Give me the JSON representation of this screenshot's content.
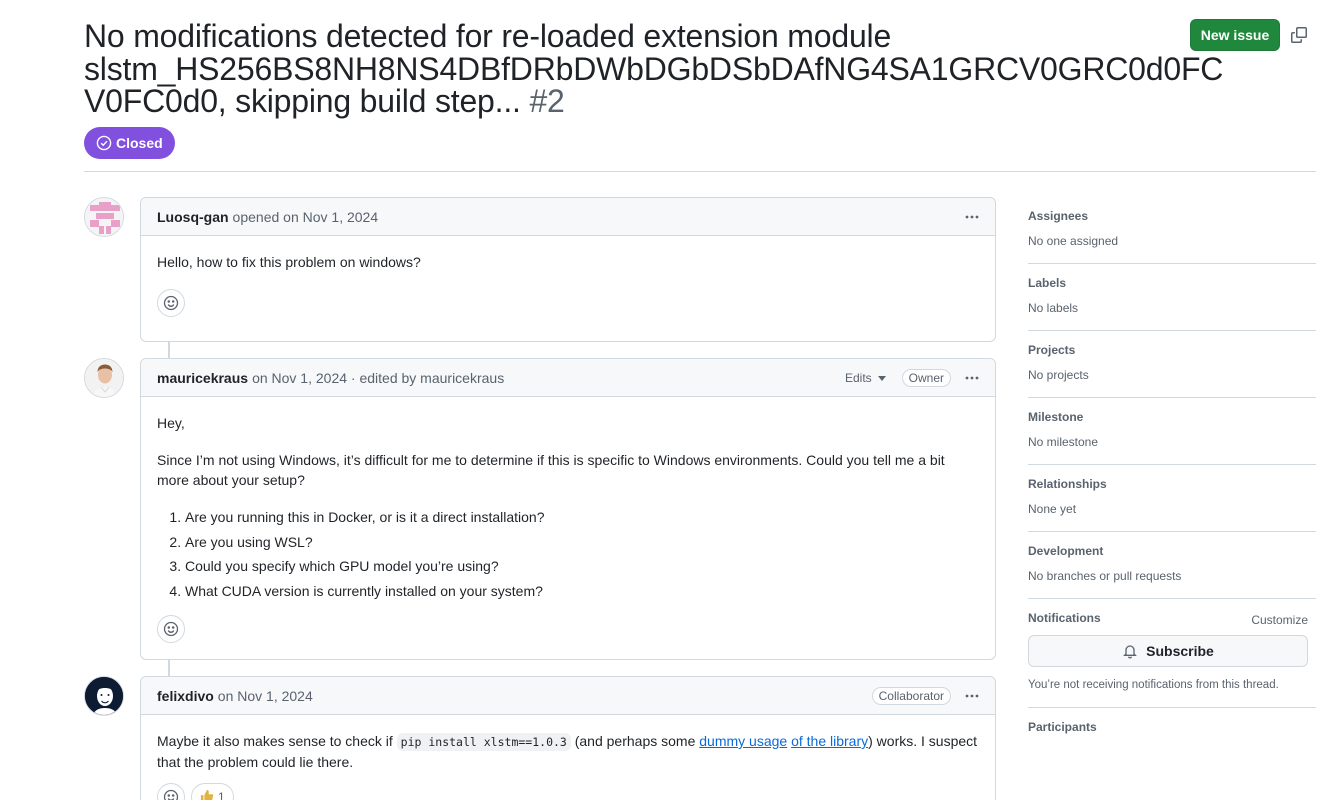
{
  "issue": {
    "title": "No modifications detected for re-loaded extension module slstm_HS256BS8NH8NS4DBfDRbDWbDGbDSbDAfNG4SA1GRCV0GRC0d0FC V0FC0d0, skipping build step...",
    "number": "#2",
    "state": "Closed"
  },
  "header": {
    "new_issue_label": "New issue"
  },
  "comments": [
    {
      "author": "Luosq-gan",
      "meta": "opened on Nov 1, 2024",
      "body": "Hello, how to fix this problem on windows?"
    },
    {
      "author": "mauricekraus",
      "meta": "on Nov 1, 2024 · edited by mauricekraus",
      "edits_label": "Edits",
      "role": "Owner",
      "greeting": "Hey,",
      "intro": "Since I’m not using Windows, it’s difficult for me to determine if this is specific to Windows environments. Could you tell me a bit more about your setup?",
      "questions": [
        "Are you running this in Docker, or is it a direct installation?",
        "Are you using WSL?",
        "Could you specify which GPU model you’re using?",
        "What CUDA version is currently installed on your system?"
      ]
    },
    {
      "author": "felixdivo",
      "meta": "on Nov 1, 2024",
      "role": "Collaborator",
      "text_before_code": "Maybe it also makes sense to check if ",
      "code": "pip install xlstm==1.0.3",
      "text_after_code": " (and perhaps some ",
      "link_text_1": "dummy usage",
      "link_text_2": "of the library",
      "text_end": ") works. I suspect that the problem could lie there.",
      "reaction_count": "1"
    }
  ],
  "sidebar": {
    "assignees_title": "Assignees",
    "assignees_value": "No one assigned",
    "labels_title": "Labels",
    "labels_value": "No labels",
    "projects_title": "Projects",
    "projects_value": "No projects",
    "milestone_title": "Milestone",
    "milestone_value": "No milestone",
    "relationships_title": "Relationships",
    "relationships_value": "None yet",
    "development_title": "Development",
    "development_value": "No branches or pull requests",
    "notifications_title": "Notifications",
    "customize_label": "Customize",
    "subscribe_label": "Subscribe",
    "notifications_note": "You’re not receiving notifications from this thread.",
    "participants_title": "Participants"
  },
  "colors": {
    "closed": "#8250df",
    "new_issue": "#1f883d",
    "link": "#0969da"
  }
}
